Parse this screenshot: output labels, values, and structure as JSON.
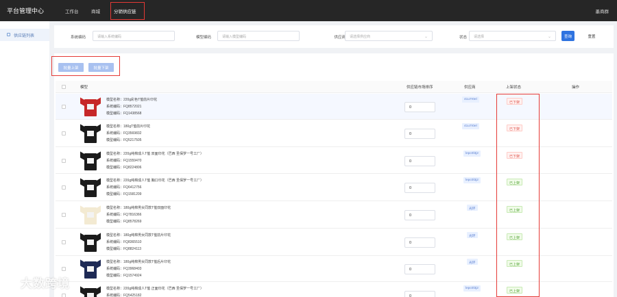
{
  "app": {
    "title": "平台管理中心",
    "user": "墨商群"
  },
  "nav": {
    "items": [
      "工作台",
      "商城",
      "分销供应链"
    ],
    "active": 2
  },
  "sidebar": {
    "items": [
      {
        "label": "供应链列表"
      }
    ]
  },
  "filters": {
    "sys_code_label": "系统编码",
    "sys_code_placeholder": "请输入系统编码",
    "model_code_label": "模型编码",
    "model_code_placeholder": "请输入模型编码",
    "supplier_label": "供应商",
    "supplier_placeholder": "请选择供应商",
    "status_label": "状态",
    "status_placeholder": "请选择",
    "query_label": "查询",
    "reset_label": "重置"
  },
  "actions": {
    "batch_on": "批量上架",
    "batch_off": "批量下架"
  },
  "table": {
    "headers": {
      "model": "模型",
      "sort": "供应链市场排序",
      "supplier": "供应商",
      "status": "上架状态",
      "ops": "操作"
    },
    "rows": [
      {
        "name": "模型名称：220g彩色T恤前片印花",
        "sys": "系统编码：FQ8572021",
        "model": "模型编码：FQ1438568",
        "sort": "0",
        "supplier": "41u7r0el",
        "status": "已下架",
        "on": false,
        "color": "#c62828"
      },
      {
        "name": "模型名称：180gT恤前片印花",
        "sys": "系统编码：FQ3569832",
        "model": "模型编码：FQ5217505",
        "sort": "0",
        "supplier": "41u7r0el",
        "status": "已下架",
        "on": false,
        "color": "#1b1b1b"
      },
      {
        "name": "模型名称：220g纯棉成人T恤 双面印花（巴西 圣保罗一号工厂）",
        "sys": "系统编码：FQ1559470",
        "model": "模型编码：FQ8224806",
        "sort": "0",
        "supplier": "lepc0l3j2",
        "status": "已下架",
        "on": false,
        "color": "#1b1b1b"
      },
      {
        "name": "模型名称：220g纯棉成人T恤 胸口印花（巴西 圣保罗一号工厂）",
        "sys": "系统编码：FQ6412756",
        "model": "模型编码：FQ1581209",
        "sort": "0",
        "supplier": "lepc0l3j2",
        "status": "已上架",
        "on": true,
        "color": "#1b1b1b"
      },
      {
        "name": "模型名称：180g纯棉男女同款T恤双面印花",
        "sys": "系统编码：FQ7816366",
        "model": "模型编码：FQ8578269",
        "sort": "0",
        "supplier": "光环",
        "status": "已上架",
        "on": true,
        "color": "#f3ead2"
      },
      {
        "name": "模型名称：180g纯棉男女同款T恤前片印花",
        "sys": "系统编码：FQ8365510",
        "model": "模型编码：FQ8824113",
        "sort": "0",
        "supplier": "光环",
        "status": "已上架",
        "on": true,
        "color": "#1b1b1b"
      },
      {
        "name": "模型名称：180g纯棉男女同款T恤后片印花",
        "sys": "系统编码：FQ3968403",
        "model": "模型编码：FQ1574924",
        "sort": "0",
        "supplier": "光环",
        "status": "已上架",
        "on": true,
        "color": "#1e2a55"
      },
      {
        "name": "模型名称：220g纯棉成人T恤 正面印花（巴西 圣保罗一号工厂）",
        "sys": "系统编码：FQ5425182",
        "model": "模型编码：",
        "sort": "0",
        "supplier": "lepc0l3j2",
        "status": "已上架",
        "on": true,
        "color": "#1b1b1b"
      }
    ]
  },
  "watermark": {
    "text": "大数跨境"
  },
  "colors": {
    "accent": "#2f73e0",
    "highlight_box": "#e53935",
    "topbar": "#262626"
  }
}
